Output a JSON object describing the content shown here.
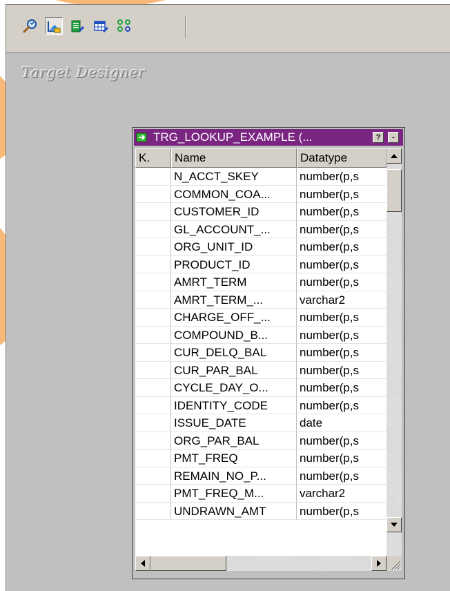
{
  "toolbar": {
    "icons": [
      "search-icon",
      "target-designer-icon",
      "list-edit-icon",
      "table-edit-icon",
      "link-icon"
    ]
  },
  "workspace": {
    "title": "Target Designer"
  },
  "table_window": {
    "title": "TRG_LOOKUP_EXAMPLE (...",
    "help_button": "?",
    "minimize_button": "-",
    "title_color": "#7b2583",
    "columns": [
      "K.",
      "Name",
      "Datatype"
    ],
    "rows": [
      {
        "key": "",
        "name": "N_ACCT_SKEY",
        "datatype": "number(p,s"
      },
      {
        "key": "",
        "name": "COMMON_COA...",
        "datatype": "number(p,s"
      },
      {
        "key": "",
        "name": "CUSTOMER_ID",
        "datatype": "number(p,s"
      },
      {
        "key": "",
        "name": "GL_ACCOUNT_...",
        "datatype": "number(p,s"
      },
      {
        "key": "",
        "name": "ORG_UNIT_ID",
        "datatype": "number(p,s"
      },
      {
        "key": "",
        "name": "PRODUCT_ID",
        "datatype": "number(p,s"
      },
      {
        "key": "",
        "name": "AMRT_TERM",
        "datatype": "number(p,s"
      },
      {
        "key": "",
        "name": "AMRT_TERM_...",
        "datatype": "varchar2"
      },
      {
        "key": "",
        "name": "CHARGE_OFF_...",
        "datatype": "number(p,s"
      },
      {
        "key": "",
        "name": "COMPOUND_B...",
        "datatype": "number(p,s"
      },
      {
        "key": "",
        "name": "CUR_DELQ_BAL",
        "datatype": "number(p,s"
      },
      {
        "key": "",
        "name": "CUR_PAR_BAL",
        "datatype": "number(p,s"
      },
      {
        "key": "",
        "name": "CYCLE_DAY_O...",
        "datatype": "number(p,s"
      },
      {
        "key": "",
        "name": "IDENTITY_CODE",
        "datatype": "number(p,s"
      },
      {
        "key": "",
        "name": "ISSUE_DATE",
        "datatype": "date"
      },
      {
        "key": "",
        "name": "ORG_PAR_BAL",
        "datatype": "number(p,s"
      },
      {
        "key": "",
        "name": "PMT_FREQ",
        "datatype": "number(p,s"
      },
      {
        "key": "",
        "name": "REMAIN_NO_P...",
        "datatype": "number(p,s"
      },
      {
        "key": "",
        "name": "PMT_FREQ_M...",
        "datatype": "varchar2"
      },
      {
        "key": "",
        "name": "UNDRAWN_AMT",
        "datatype": "number(p,s"
      }
    ]
  }
}
